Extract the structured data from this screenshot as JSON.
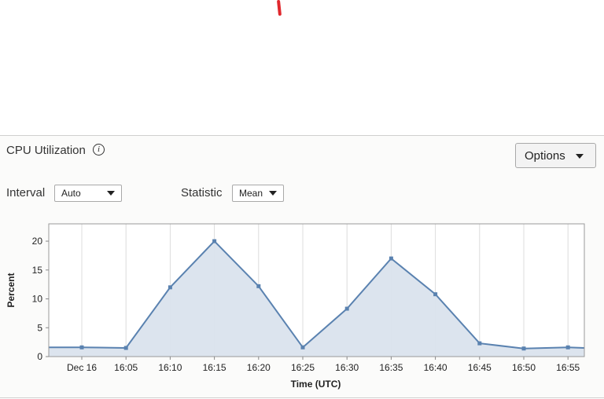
{
  "widget": {
    "title": "CPU Utilization",
    "info_icon": "info-icon",
    "options_label": "Options",
    "interval": {
      "label": "Interval",
      "selected": "Auto"
    },
    "statistic": {
      "label": "Statistic",
      "selected": "Mean"
    }
  },
  "colors": {
    "line": "#5a82b0",
    "fill": "#dae3ed",
    "accent_mark": "#e0282d"
  },
  "chart_data": {
    "type": "area",
    "title": "",
    "xlabel": "Time (UTC)",
    "ylabel": "Percent",
    "x": [
      "16:00",
      "16:05",
      "16:10",
      "16:15",
      "16:20",
      "16:25",
      "16:30",
      "16:35",
      "16:40",
      "16:45",
      "16:50",
      "16:55"
    ],
    "tick_labels": [
      "Dec 16",
      "16:05",
      "16:10",
      "16:15",
      "16:20",
      "16:25",
      "16:30",
      "16:35",
      "16:40",
      "16:45",
      "16:50",
      "16:55"
    ],
    "series": [
      {
        "values": [
          1.6,
          1.6,
          1.5,
          12,
          20,
          12.2,
          1.6,
          8.3,
          17,
          10.8,
          2.3,
          1.4,
          1.6,
          1.5
        ]
      }
    ],
    "y_ticks": [
      0,
      5,
      10,
      15,
      20
    ],
    "ylim": [
      0,
      23
    ],
    "grid": "vertical"
  }
}
